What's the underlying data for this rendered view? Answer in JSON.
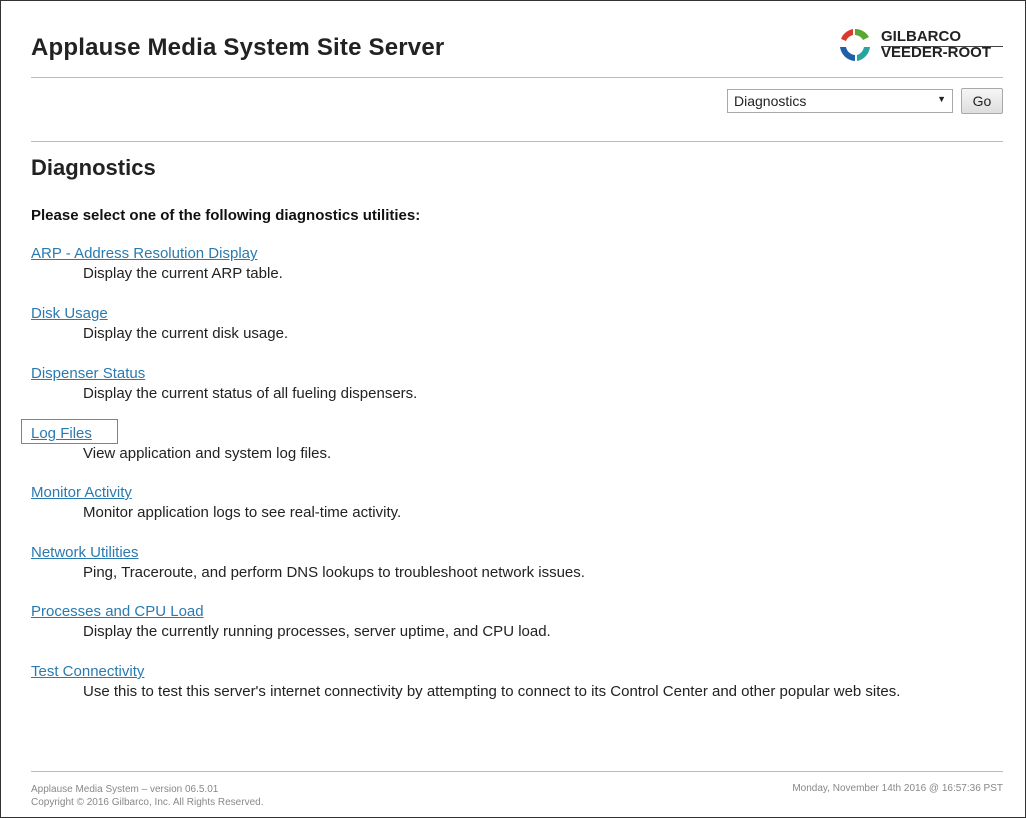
{
  "header": {
    "title": "Applause Media System Site Server",
    "logo_line1": "GILBARCO",
    "logo_line2": "VEEDER-ROOT"
  },
  "nav": {
    "selected": "Diagnostics",
    "go_label": "Go"
  },
  "main": {
    "heading": "Diagnostics",
    "intro": "Please select one of the following diagnostics utilities:",
    "utilities": [
      {
        "label": "ARP - Address Resolution Display",
        "description": "Display the current ARP table."
      },
      {
        "label": "Disk Usage",
        "description": "Display the current disk usage."
      },
      {
        "label": "Dispenser Status",
        "description": "Display the current status of all fueling dispensers."
      },
      {
        "label": "Log Files",
        "description": "View application and system log files."
      },
      {
        "label": "Monitor Activity",
        "description": "Monitor application logs to see real-time activity."
      },
      {
        "label": "Network Utilities",
        "description": "Ping, Traceroute, and perform DNS lookups to troubleshoot network issues."
      },
      {
        "label": "Processes and CPU Load",
        "description": "Display the currently running processes, server uptime, and CPU load."
      },
      {
        "label": "Test Connectivity",
        "description": "Use this to test this server's internet connectivity by attempting to connect to its Control Center and other popular web sites."
      }
    ]
  },
  "footer": {
    "version": "Applause Media System – version 06.5.01",
    "copyright": "Copyright © 2016 Gilbarco, Inc. All Rights Reserved.",
    "timestamp": "Monday, November 14th 2016 @ 16:57:36 PST"
  },
  "colors": {
    "link": "#2a7ab0",
    "highlight": "#e040e0",
    "logo_green": "#5aa832",
    "logo_red": "#d93a2b",
    "logo_blue": "#1f5fa8",
    "logo_teal": "#2aa3a0"
  },
  "icons": {
    "logo": "gilbarco-logo-icon",
    "dropdown_arrow": "chevron-down-icon"
  }
}
